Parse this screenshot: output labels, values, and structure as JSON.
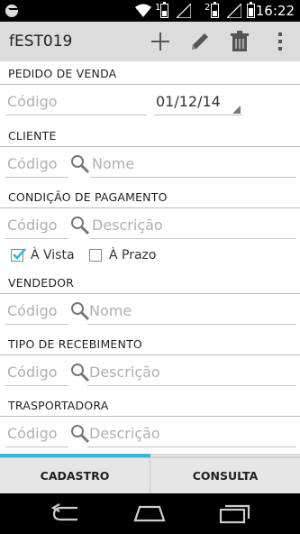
{
  "status_bar": {
    "time": "16:22",
    "sim1": "1",
    "sim2": "2",
    "battery_level": 0.7
  },
  "app_bar": {
    "title": "fEST019",
    "icons": [
      "add-icon",
      "edit-icon",
      "delete-icon",
      "overflow-menu-icon"
    ]
  },
  "form": {
    "pedido": {
      "header": "PEDIDO DE VENDA",
      "codigo_placeholder": "Código",
      "date": "01/12/14"
    },
    "cliente": {
      "header": "CLIENTE",
      "codigo_placeholder": "Código",
      "nome_placeholder": "Nome"
    },
    "pagamento": {
      "header": "CONDIÇÃO DE PAGAMENTO",
      "codigo_placeholder": "Código",
      "descricao_placeholder": "Descrição",
      "options": [
        {
          "label": "À Vista",
          "checked": true
        },
        {
          "label": "À Prazo",
          "checked": false
        }
      ]
    },
    "vendedor": {
      "header": "VENDEDOR",
      "codigo_placeholder": "Código",
      "nome_placeholder": "Nome"
    },
    "recebimento": {
      "header": "TIPO DE RECEBIMENTO",
      "codigo_placeholder": "Código",
      "descricao_placeholder": "Descrição"
    },
    "transportadora": {
      "header": "TRASPORTADORA",
      "codigo_placeholder": "Código",
      "descricao_placeholder": "Descrição"
    }
  },
  "progress": 0.5,
  "tabs": {
    "cadastro": "CADASTRO",
    "consulta": "CONSULTA"
  },
  "colors": {
    "accent": "#33b5e5",
    "action_bar": "#dcdcdc",
    "checkbox": "#33b5e5"
  }
}
